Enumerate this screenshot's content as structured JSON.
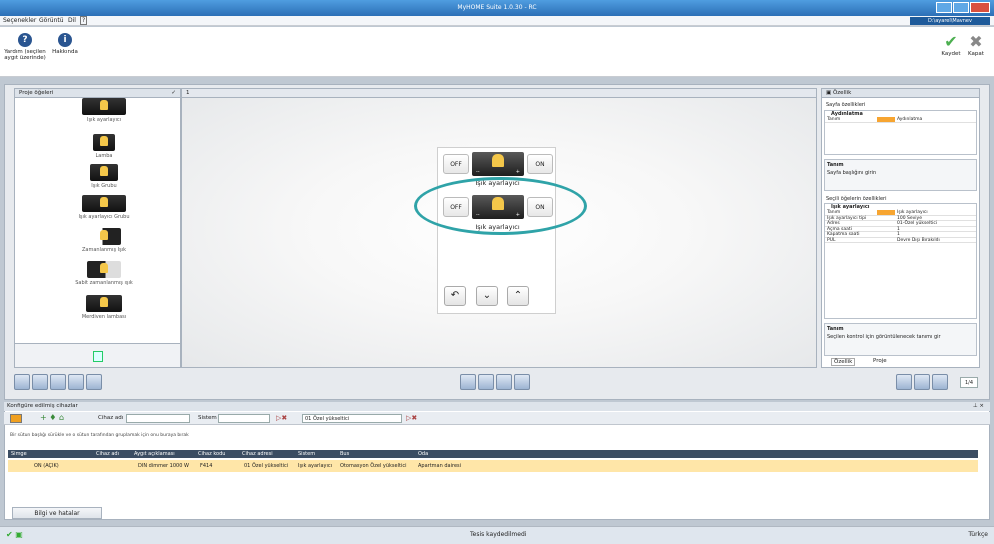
{
  "window": {
    "title": "MyHOME Suite 1.0.30 - RC"
  },
  "menu": {
    "items": [
      "Seçenekler",
      "Görüntü",
      "Dil",
      "?"
    ],
    "user": "D:\\ayarel\\Mavnev"
  },
  "toolbar": {
    "help": "Yardım (seçilen aygıt üzerinde)",
    "about": "Hakkında",
    "save": "Kaydet",
    "close": "Kapat"
  },
  "left_panel": {
    "title": "Proje öğeleri",
    "items": [
      "Işık ayarlayıcı",
      "Lamba",
      "Işık Grubu",
      "Işık ayarlayıcı Grubu",
      "Zamanlanmış Işık",
      "Sabit zamanlanmış ışık",
      "Merdiven lambası"
    ]
  },
  "center": {
    "tab": "1",
    "dimmer": {
      "off": "OFF",
      "on": "ON",
      "minus": "--",
      "plus": "+",
      "label": "Işık ayarlayıcı"
    }
  },
  "right_panel": {
    "title": "Özellik",
    "page_props": "Sayfa özellikleri",
    "page_group": "Aydınlatma",
    "page_rows": [
      {
        "k": "Tanım",
        "v": "Aydınlatma"
      }
    ],
    "desc1_title": "Tanım",
    "desc1_text": "Sayfa başlığını girin",
    "item_props": "Seçili öğelerin özellikleri",
    "item_group": "Işık ayarlayıcı",
    "item_rows": [
      {
        "k": "Tanım",
        "v": "Işık ayarlayıcı"
      },
      {
        "k": "Işık ayarlayıcı tipi",
        "v": "100 Seviye"
      },
      {
        "k": "Adres",
        "v": "01-Özel yükseltici"
      },
      {
        "k": "Açma saati",
        "v": "1"
      },
      {
        "k": "Kapatma saati",
        "v": "1"
      },
      {
        "k": "PUL",
        "v": "Devre Dışı Bırakıldı"
      }
    ],
    "desc2_title": "Tanım",
    "desc2_text": "Seçilen kontrol için görüntülenecek tanımı gir",
    "tabs": [
      "Özellik",
      "Proje"
    ],
    "page_counter": "1/4"
  },
  "bottom": {
    "title": "Konfigüre edilmiş cihazlar",
    "filter": {
      "cihaz_adi": "Cihaz adı",
      "sistem": "Sistem",
      "selected": "01 Özel yükseltici"
    },
    "group_hint": "Bir sütun başlığı sürükle ve o sütun tarafından gruplamak için onu buraya bırak",
    "columns": [
      "Simge",
      "Cihaz adı",
      "Aygıt açıklaması",
      "Cihaz kodu",
      "Cihaz adresi",
      "Sistem",
      "Bus",
      "Oda"
    ],
    "rows": [
      {
        "icon": "ON (AÇIK)",
        "name": "",
        "desc": "DIN dimmer 1000 W",
        "code": "F414",
        "addr": "01 Özel yükseltici",
        "sys": "Işık ayarlayıcı",
        "bus": "Otomasyon Özel yükseltici",
        "room": "Apartman dairesi"
      }
    ],
    "bilgi": "Bilgi ve hatalar"
  },
  "status": {
    "center": "Tesis kaydedilmedi",
    "right": "Türkçe"
  },
  "colors": {
    "accent": "#2fa3a8",
    "titlebar": "#3a86cf",
    "highlight_row": "#ffe6a8"
  }
}
